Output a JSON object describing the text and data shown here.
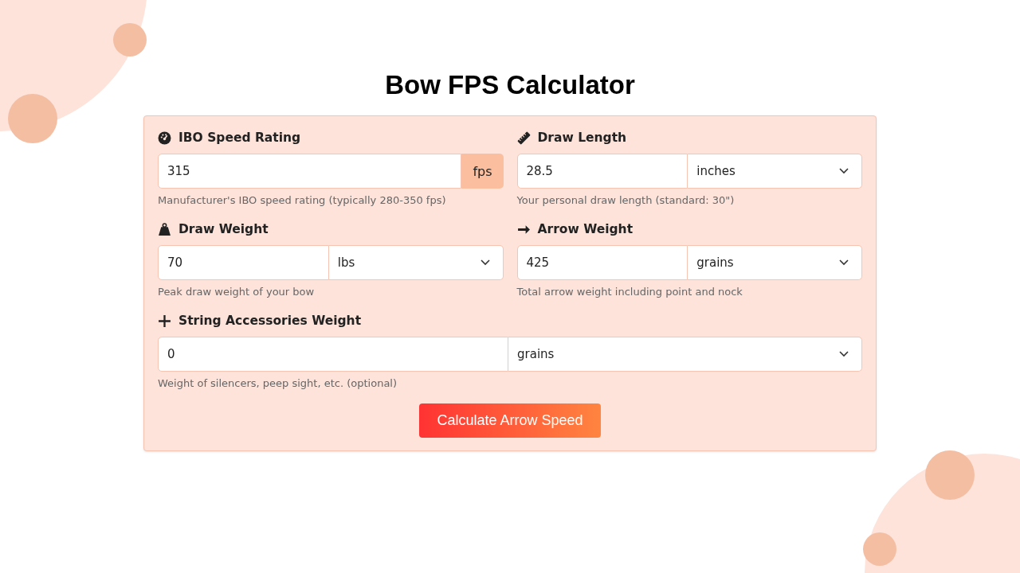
{
  "title": "Bow FPS Calculator",
  "fields": [
    {
      "label": "IBO Speed Rating",
      "value": "315",
      "unit": "fps",
      "kind": "suffix",
      "help": "Manufacturer's IBO speed rating (typically 280-350 fps)",
      "wide": false
    },
    {
      "label": "Draw Length",
      "value": "28.5",
      "unit": "inches",
      "kind": "select",
      "help": "Your personal draw length (standard: 30\")",
      "wide": false
    },
    {
      "label": "Draw Weight",
      "value": "70",
      "unit": "lbs",
      "kind": "select",
      "help": "Peak draw weight of your bow",
      "wide": false
    },
    {
      "label": "Arrow Weight",
      "value": "425",
      "unit": "grains",
      "kind": "select",
      "help": "Total arrow weight including point and nock",
      "wide": false
    },
    {
      "label": "String Accessories Weight",
      "value": "0",
      "unit": "grains",
      "kind": "select",
      "help": "Weight of silencers, peep sight, etc. (optional)",
      "wide": true
    }
  ],
  "button": "Calculate Arrow Speed"
}
